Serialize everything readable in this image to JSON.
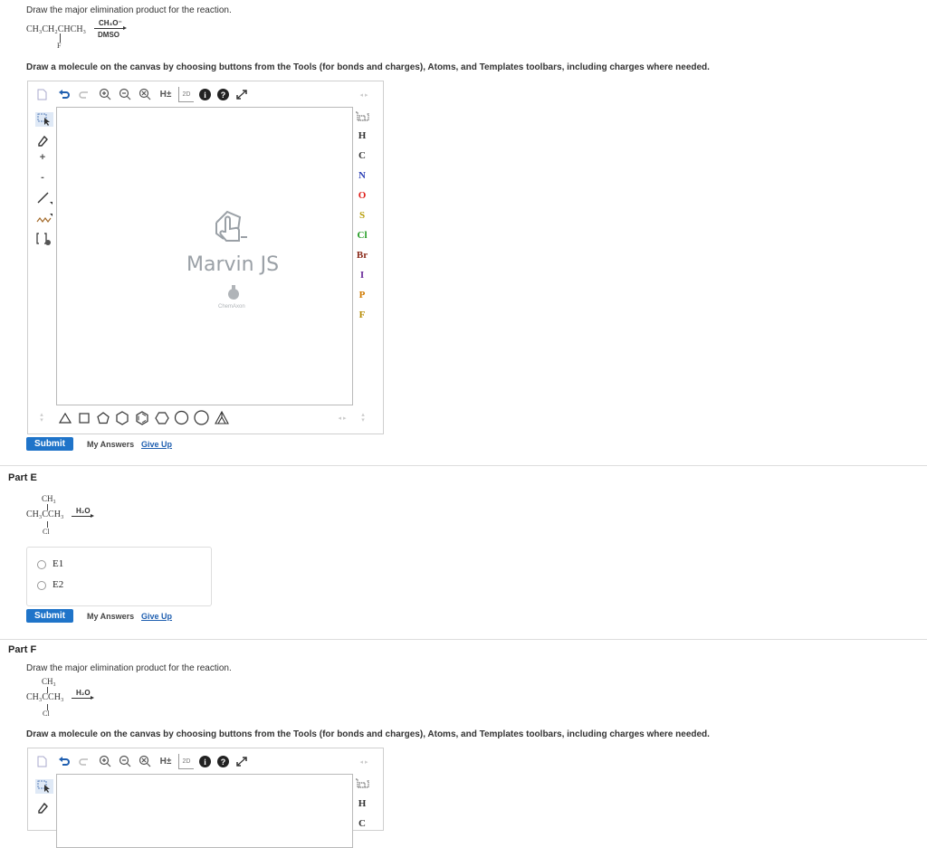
{
  "part_d": {
    "prompt": "Draw the major elimination product for the reaction.",
    "reactant": {
      "main": "CH₃CH₂CHCH₃",
      "substituent": "F"
    },
    "reagent_top": "CH₃O⁻",
    "reagent_bottom": "DMSO",
    "instruction": "Draw a molecule on the canvas by choosing buttons from the Tools (for bonds and charges), Atoms, and Templates toolbars, including charges where needed.",
    "submit_label": "Submit",
    "my_answers_label": "My Answers",
    "give_up_label": "Give Up"
  },
  "editor": {
    "brand": "Marvin JS",
    "brand_sub": "ChemAxon",
    "top_tools": [
      "new-document-icon",
      "undo-icon",
      "redo-icon",
      "zoom-in-icon",
      "zoom-out-icon",
      "clear-icon",
      "h-toggle-icon",
      "2d-clean-icon",
      "info-icon",
      "help-icon",
      "fullscreen-icon"
    ],
    "h_toggle_label": "H±",
    "clean_label": "2D",
    "left_tools": [
      "select-icon",
      "erase-icon",
      "charge-plus-icon",
      "charge-minus-icon",
      "single-bond-icon",
      "chain-icon",
      "bracket-icon"
    ],
    "charge_plus": "+",
    "charge_minus": "-",
    "atoms": [
      {
        "symbol": "H",
        "color": "#333333"
      },
      {
        "symbol": "C",
        "color": "#333333"
      },
      {
        "symbol": "N",
        "color": "#2b3fb5"
      },
      {
        "symbol": "O",
        "color": "#e0201b"
      },
      {
        "symbol": "S",
        "color": "#b59a00"
      },
      {
        "symbol": "Cl",
        "color": "#1f9a1f"
      },
      {
        "symbol": "Br",
        "color": "#8a2a1a"
      },
      {
        "symbol": "I",
        "color": "#6a2a9a"
      },
      {
        "symbol": "P",
        "color": "#d07a00"
      },
      {
        "symbol": "F",
        "color": "#b58a00"
      }
    ],
    "templates": [
      "triangle",
      "square",
      "pentagon",
      "hexagon",
      "hexagon-alt",
      "heptagon",
      "octagon",
      "naphthalene-fragment"
    ]
  },
  "part_e": {
    "title": "Part E",
    "reactant": {
      "top": "CH₃",
      "main": "CH₃CCH₃",
      "bottom": "Cl"
    },
    "reagent_top": "H₂O",
    "options": [
      "E1",
      "E2"
    ],
    "submit_label": "Submit",
    "my_answers_label": "My Answers",
    "give_up_label": "Give Up"
  },
  "part_f": {
    "title": "Part F",
    "prompt": "Draw the major elimination product for the reaction.",
    "reactant": {
      "top": "CH₃",
      "main": "CH₃CCH₃",
      "bottom": "Cl"
    },
    "reagent_top": "H₂O",
    "instruction": "Draw a molecule on the canvas by choosing buttons from the Tools (for bonds and charges), Atoms, and Templates toolbars, including charges where needed.",
    "atoms_visible": [
      {
        "symbol": "H",
        "color": "#333333"
      },
      {
        "symbol": "C",
        "color": "#333333"
      }
    ]
  }
}
